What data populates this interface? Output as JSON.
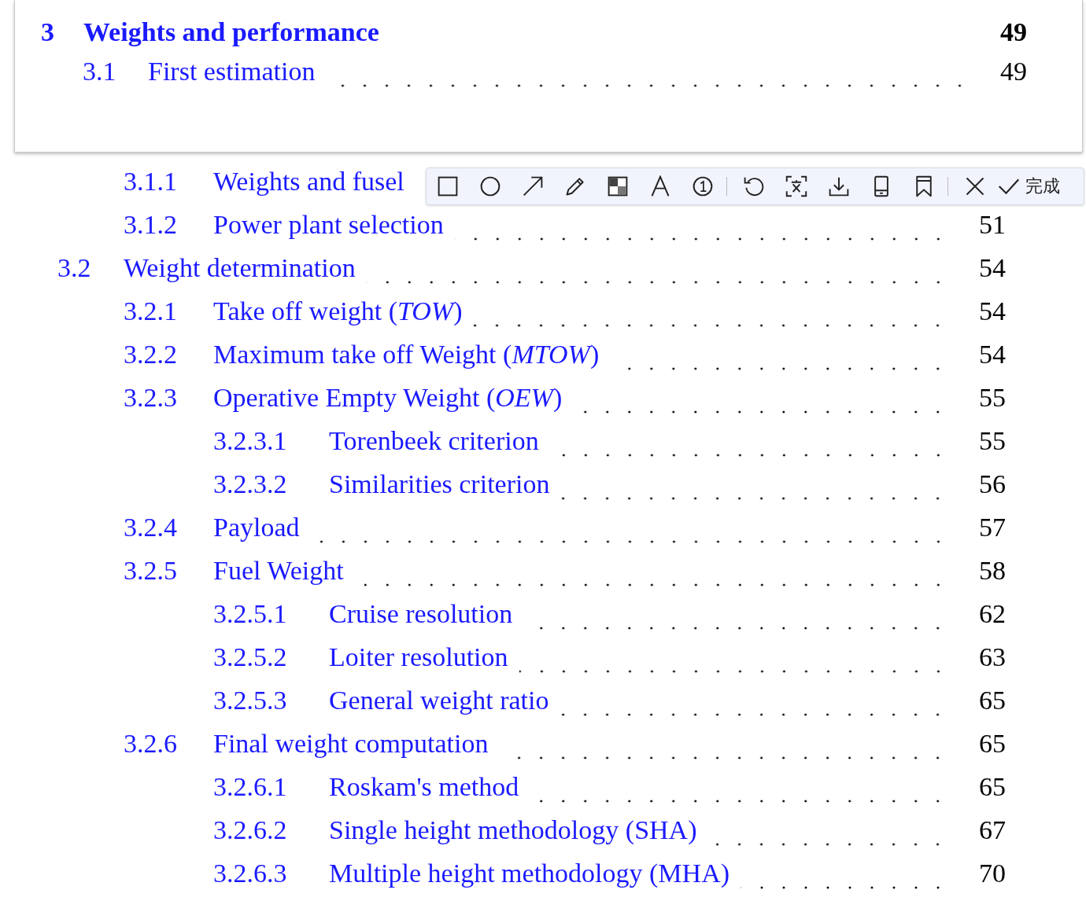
{
  "top_panel": {
    "chapter": {
      "number": "3",
      "title": "Weights and performance",
      "page": "49",
      "children": [
        {
          "number": "3.1",
          "title": "First estimation",
          "page": "49"
        }
      ]
    }
  },
  "continued_entries": [
    {
      "number": "3.1.1",
      "title": "Weights and fusel"
    },
    {
      "number": "3.1.2",
      "title": "Power plant selection",
      "page": "51"
    }
  ],
  "sections": [
    {
      "number": "3.2",
      "title": "Weight determination",
      "page": "54",
      "children": [
        {
          "number": "3.2.1",
          "title": "Take off weight (*TOW*)",
          "page": "54"
        },
        {
          "number": "3.2.2",
          "title": "Maximum take off Weight (*MTOW*)",
          "page": "54"
        },
        {
          "number": "3.2.3",
          "title": "Operative Empty Weight (*OEW*)",
          "page": "55",
          "children": [
            {
              "number": "3.2.3.1",
              "title": "Torenbeek criterion",
              "page": "55"
            },
            {
              "number": "3.2.3.2",
              "title": "Similarities criterion",
              "page": "56"
            }
          ]
        },
        {
          "number": "3.2.4",
          "title": "Payload",
          "page": "57"
        },
        {
          "number": "3.2.5",
          "title": "Fuel Weight",
          "page": "58",
          "children": [
            {
              "number": "3.2.5.1",
              "title": "Cruise resolution",
              "page": "62"
            },
            {
              "number": "3.2.5.2",
              "title": "Loiter resolution",
              "page": "63"
            },
            {
              "number": "3.2.5.3",
              "title": "General weight ratio",
              "page": "65"
            }
          ]
        },
        {
          "number": "3.2.6",
          "title": "Final weight computation",
          "page": "65",
          "children": [
            {
              "number": "3.2.6.1",
              "title": "Roskam's method",
              "page": "65"
            },
            {
              "number": "3.2.6.2",
              "title": "Single height methodology (SHA)",
              "page": "67"
            },
            {
              "number": "3.2.6.3",
              "title": "Multiple height methodology (MHA)",
              "page": "70"
            }
          ]
        }
      ]
    }
  ],
  "toolbar": {
    "done_label": "完成"
  }
}
